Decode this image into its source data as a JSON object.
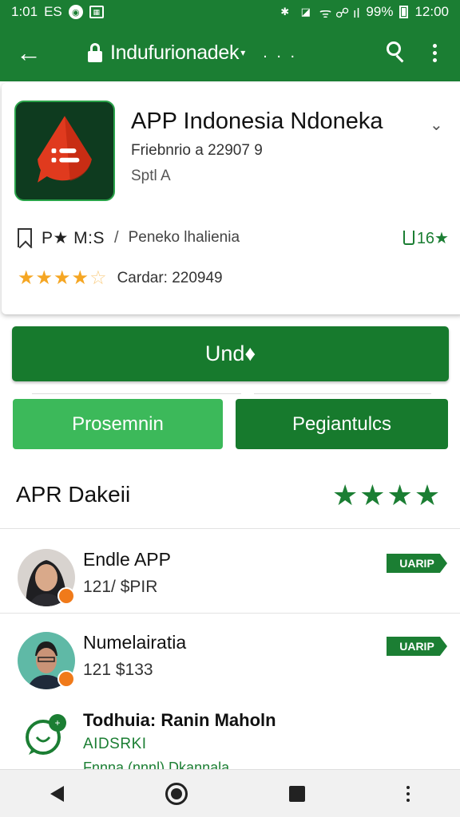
{
  "status_bar": {
    "time_left": "1:01",
    "carrier": "ES",
    "right_icons": "ᯤ ☍ ıl",
    "battery_pct": "99%",
    "time_right": "12:00"
  },
  "app_bar": {
    "title": "Indufurionadek",
    "trailing_dots": ". . ."
  },
  "app": {
    "name": "APP Indonesia Ndoneka",
    "date": "Friebnrio a 22907 9",
    "subtitle": "Sptl A",
    "meta_label": "P★ M:S",
    "meta_sep": "/",
    "developer": "Peneko lhalienia",
    "likes": "16★",
    "stars": "★★★★",
    "half_star": "☆",
    "rating_text": "Cardar: 220949"
  },
  "buttons": {
    "install": "Und ",
    "install_icon": "♦",
    "left": "Prosemnin",
    "right": "Pegiantulcs"
  },
  "section": {
    "title": "APR Dakeii",
    "stars": "★★★★"
  },
  "reviews": [
    {
      "name": "Endle APP",
      "meta": "121/ $PIR",
      "badge": "UARIP"
    },
    {
      "name": "Numelairatia",
      "meta": "121  $133",
      "badge": "UARIP"
    }
  ],
  "review3": {
    "name": "Todhuia: Ranin Maholn",
    "tag": "AIDSRKI",
    "cut_text": "Fnnna (nnnl) Dkannala"
  },
  "colors": {
    "primary": "#1b7e33",
    "accent_light": "#3cb95a",
    "star": "#f5a623",
    "badge_orange": "#f07a1a"
  }
}
